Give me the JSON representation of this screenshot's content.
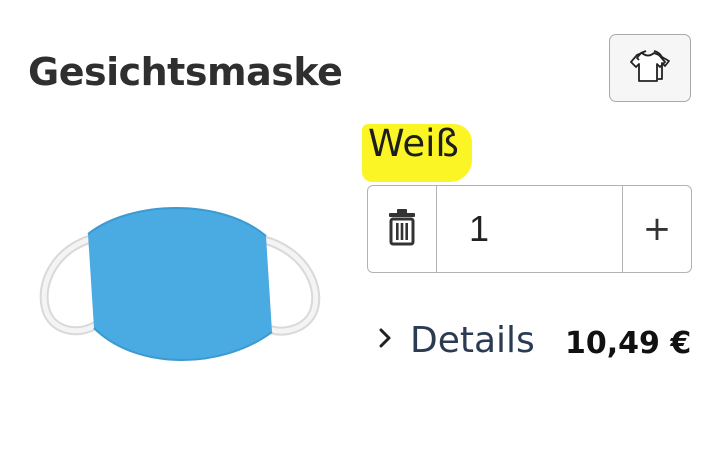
{
  "product": {
    "title": "Gesichtsmaske",
    "color": "Weiß",
    "image_icon": "face-mask-image",
    "mask_color": "#4aabe3"
  },
  "quantity": {
    "value": "1",
    "delete_icon": "trash-icon",
    "increment_label": "+"
  },
  "details": {
    "label": "Details",
    "icon": "chevron-right-icon"
  },
  "price": "10,49 €",
  "actions": {
    "shirt_icon": "tshirt-icon"
  },
  "colors": {
    "highlight": "#fcf526",
    "text": "#2d2d2d",
    "details_text": "#2a3b52"
  }
}
